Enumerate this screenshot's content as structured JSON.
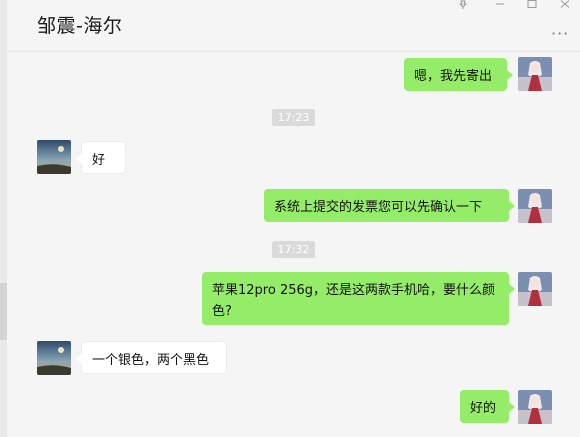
{
  "header": {
    "title": "邹震-海尔",
    "more_icon": "more-icon"
  },
  "window_controls": [
    "pin-icon",
    "minimize-icon",
    "maximize-icon",
    "close-icon"
  ],
  "colors": {
    "sent_bubble": "#95ec69",
    "received_bubble": "#ffffff",
    "timestamp_bg": "#dadada",
    "background": "#f5f5f5"
  },
  "messages": [
    {
      "type": "message",
      "side": "right",
      "text": "嗯，我先寄出"
    },
    {
      "type": "time",
      "text": "17:23"
    },
    {
      "type": "message",
      "side": "left",
      "text": "好"
    },
    {
      "type": "message",
      "side": "right",
      "text": "系统上提交的发票您可以先确认一下"
    },
    {
      "type": "time",
      "text": "17:32"
    },
    {
      "type": "message",
      "side": "right",
      "text": "苹果12pro 256g，还是这两款手机哈，要什么颜色?"
    },
    {
      "type": "message",
      "side": "left",
      "text": "一个银色，两个黑色"
    },
    {
      "type": "message",
      "side": "right",
      "text": "好的"
    }
  ]
}
